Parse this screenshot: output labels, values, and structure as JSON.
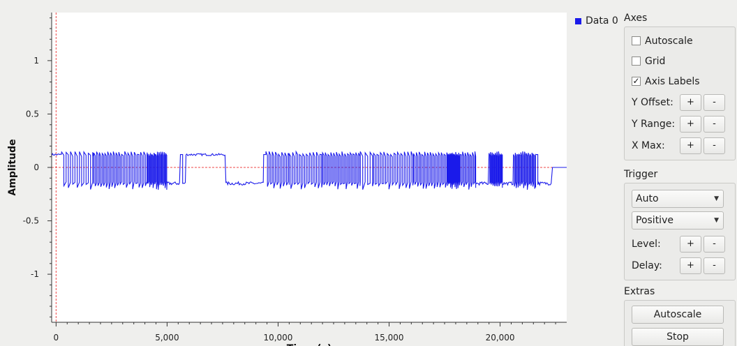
{
  "colors": {
    "series": "#1a1aea",
    "reference": "#ee4444",
    "background": "#ffffff",
    "panel": "#efefed"
  },
  "legend": {
    "label": "Data 0",
    "icon": "legend-square-icon"
  },
  "axes_group": {
    "title": "Axes",
    "autoscale": {
      "label": "Autoscale",
      "checked": false
    },
    "grid": {
      "label": "Grid",
      "checked": false
    },
    "axis_labels": {
      "label": "Axis Labels",
      "checked": true,
      "mark": "✓"
    },
    "y_offset": {
      "label": "Y Offset:",
      "plus": "+",
      "minus": "-"
    },
    "y_range": {
      "label": "Y Range:",
      "plus": "+",
      "minus": "-"
    },
    "x_max": {
      "label": "X Max:",
      "plus": "+",
      "minus": "-"
    }
  },
  "trigger_group": {
    "title": "Trigger",
    "mode": "Auto",
    "slope": "Positive",
    "level": {
      "label": "Level:",
      "plus": "+",
      "minus": "-"
    },
    "delay": {
      "label": "Delay:",
      "plus": "+",
      "minus": "-"
    }
  },
  "extras_group": {
    "title": "Extras",
    "autoscale_button": "Autoscale",
    "stop_button": "Stop"
  },
  "chart_data": {
    "type": "line",
    "title": "",
    "ylabel": "Amplitude",
    "xlabel": "Time (s)",
    "xlim": [
      -200,
      23000
    ],
    "ylim": [
      -1.45,
      1.45
    ],
    "x_ticks": [
      0,
      5000,
      10000,
      15000,
      20000
    ],
    "x_tick_labels": [
      "0",
      "5,000",
      "10,000",
      "15,000",
      "20,000"
    ],
    "y_ticks": [
      1,
      0.5,
      0,
      -0.5,
      -1
    ],
    "y_tick_labels": [
      "1",
      "0.5",
      "0",
      "-0.5",
      "-1"
    ],
    "grid": false,
    "legend_position": "right",
    "series": [
      {
        "name": "Data 0",
        "high_level": 0.12,
        "low_level": -0.15,
        "end_level": 0.0,
        "end_x": 22300,
        "segments": [
          [
            -200,
            250,
            1
          ],
          [
            250,
            1700,
            0.5
          ],
          [
            1700,
            2950,
            0.8
          ],
          [
            2950,
            4100,
            0.7
          ],
          [
            4100,
            5000,
            1.3
          ],
          [
            5000,
            5600,
            0
          ],
          [
            5600,
            5700,
            1
          ],
          [
            5700,
            5850,
            0
          ],
          [
            5850,
            7650,
            1
          ],
          [
            7650,
            9350,
            0
          ],
          [
            9350,
            9450,
            1
          ],
          [
            9450,
            10500,
            0.7
          ],
          [
            10500,
            12000,
            0.65
          ],
          [
            12000,
            13700,
            0.8
          ],
          [
            13700,
            14300,
            0.45
          ],
          [
            14300,
            16100,
            0.65
          ],
          [
            16100,
            17600,
            0.8
          ],
          [
            17600,
            18200,
            1.5
          ],
          [
            18200,
            18900,
            0.9
          ],
          [
            18900,
            19500,
            0
          ],
          [
            19500,
            20100,
            1.4
          ],
          [
            20100,
            20600,
            0
          ],
          [
            20600,
            21600,
            1.2
          ],
          [
            21600,
            21700,
            1
          ],
          [
            21700,
            22300,
            0
          ]
        ]
      }
    ],
    "reference_lines": {
      "x": 0,
      "y": 0,
      "style": "dashed"
    }
  }
}
